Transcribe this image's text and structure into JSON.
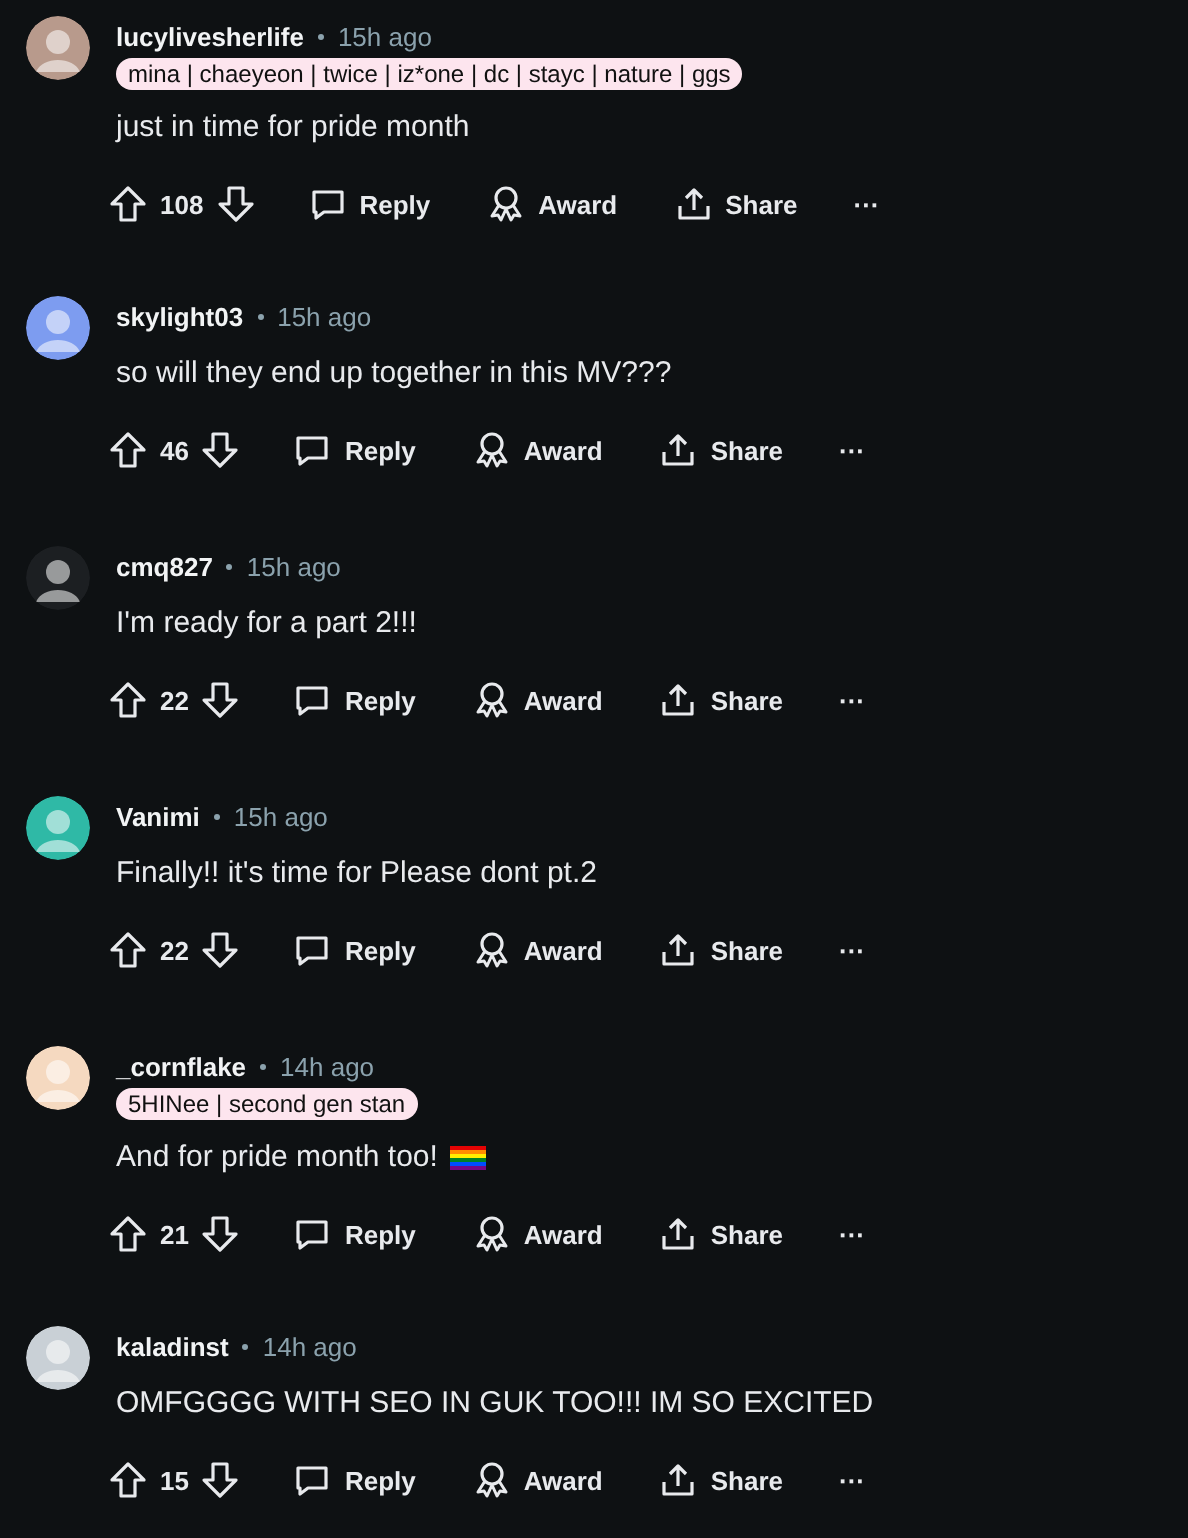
{
  "comments": [
    {
      "author": "lucylivesherlife",
      "time": "15h ago",
      "flair": "mina | chaeyeon | twice | iz*one | dc | stayc | nature | ggs",
      "body": "just in time for pride month",
      "votes": "108",
      "avatar": {
        "color": "#b89a8c"
      },
      "actions": [
        "Reply",
        "Award",
        "Share"
      ],
      "more": "···"
    },
    {
      "author": "skylight03",
      "time": "15h ago",
      "body": "so will they end up together in this MV???",
      "votes": "46",
      "avatar": {
        "color": "#7d9cf0"
      },
      "actions": [
        "Reply",
        "Award",
        "Share"
      ],
      "more": "···"
    },
    {
      "author": "cmq827",
      "time": "15h ago",
      "body": "I'm ready for a part 2!!!",
      "votes": "22",
      "avatar": {
        "color": "#1c1f22"
      },
      "actions": [
        "Reply",
        "Award",
        "Share"
      ],
      "more": "···"
    },
    {
      "author": "Vanimi",
      "time": "15h ago",
      "body": "Finally!! it's time for Please dont pt.2",
      "votes": "22",
      "avatar": {
        "color": "#2fb9a6"
      },
      "actions": [
        "Reply",
        "Award",
        "Share"
      ],
      "more": "···"
    },
    {
      "author": "_cornflake",
      "time": "14h ago",
      "flair": "5HINee | second gen stan",
      "body": "And for pride month too!",
      "has_flag_icon": true,
      "votes": "21",
      "avatar": {
        "color": "#f5d9c0"
      },
      "actions": [
        "Reply",
        "Award",
        "Share"
      ],
      "more": "···"
    },
    {
      "author": "kaladinst",
      "time": "14h ago",
      "body": "OMFGGGG WITH SEO IN GUK TOO!!! IM SO EXCITED",
      "votes": "15",
      "avatar": {
        "color": "#c9d0d6"
      },
      "actions": [
        "Reply",
        "Award",
        "Share"
      ],
      "more": "···"
    }
  ]
}
